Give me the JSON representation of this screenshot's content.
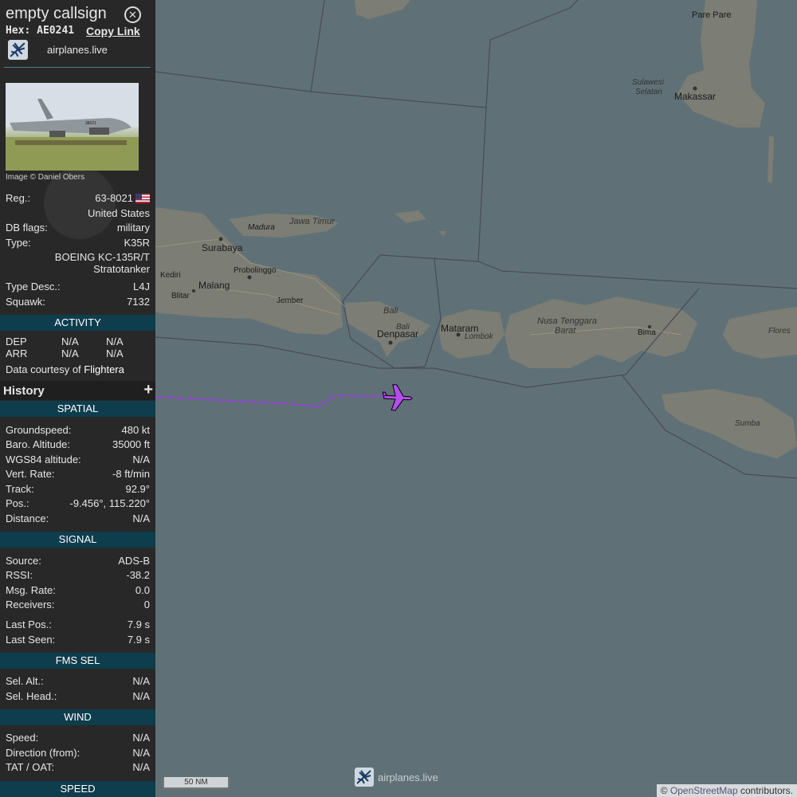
{
  "header": {
    "callsign": "empty callsign",
    "hex_label": "Hex:",
    "hex_value": "AE0241",
    "copy_link": "Copy Link",
    "site": "airplanes.live"
  },
  "photo": {
    "credit": "Image © Daniel Obers",
    "tail_number": "38021"
  },
  "info": {
    "reg_label": "Reg.:",
    "reg_value": "63-8021",
    "country": "United States",
    "db_flags_label": "DB flags:",
    "db_flags_value": "military",
    "type_label": "Type:",
    "type_value": "K35R",
    "type_name_1": "BOEING KC-135R/T",
    "type_name_2": "Stratotanker",
    "type_desc_label": "Type Desc.:",
    "type_desc_value": "L4J",
    "squawk_label": "Squawk:",
    "squawk_value": "7132"
  },
  "activity": {
    "title": "ACTIVITY",
    "dep": "DEP",
    "dep_1": "N/A",
    "dep_2": "N/A",
    "arr": "ARR",
    "arr_1": "N/A",
    "arr_2": "N/A",
    "courtesy_prefix": "Data courtesy of",
    "courtesy_link": "Flightera"
  },
  "history": {
    "title": "History",
    "toggle": "+"
  },
  "spatial": {
    "title": "SPATIAL",
    "groundspeed_label": "Groundspeed:",
    "groundspeed_value": "480",
    "groundspeed_unit": "kt",
    "baro_label": "Baro. Altitude:",
    "baro_value": "35000",
    "baro_unit": "ft",
    "wgs_label": "WGS84 altitude:",
    "wgs_value": "N/A",
    "vert_label": "Vert. Rate:",
    "vert_value": "-8",
    "vert_unit": "ft/min",
    "track_label": "Track:",
    "track_value": "92.9°",
    "pos_label": "Pos.:",
    "pos_value": "-9.456°, 115.220°",
    "distance_label": "Distance:",
    "distance_value": "N/A"
  },
  "signal": {
    "title": "SIGNAL",
    "source_label": "Source:",
    "source_value": "ADS-B",
    "rssi_label": "RSSI:",
    "rssi_value": "-38.2",
    "msg_label": "Msg. Rate:",
    "msg_value": "0.0",
    "receivers_label": "Receivers:",
    "receivers_value": "0",
    "lastpos_label": "Last Pos.:",
    "lastpos_value": "7.9 s",
    "lastseen_label": "Last Seen:",
    "lastseen_value": "7.9 s"
  },
  "fms": {
    "title": "FMS SEL",
    "alt_label": "Sel. Alt.:",
    "alt_value": "N/A",
    "head_label": "Sel. Head.:",
    "head_value": "N/A"
  },
  "wind": {
    "title": "WIND",
    "speed_label": "Speed:",
    "speed_value": "N/A",
    "dir_label": "Direction (from):",
    "dir_value": "N/A",
    "tat_label": "TAT / OAT:",
    "tat_value": "N/A"
  },
  "speed": {
    "title": "SPEED"
  },
  "map": {
    "scale": "50 NM",
    "brand": "airplanes.live",
    "attribution_prefix": "©",
    "attribution_link": "OpenStreetMap",
    "attribution_suffix": "contributors.",
    "labels": {
      "pare_pare": "Pare Pare",
      "sulawesi_1": "Sulawesi",
      "sulawesi_2": "Selatan",
      "makassar": "Makassar",
      "madura": "Madura",
      "jawa_timur": "Jawa Timur",
      "surabaya": "Surabaya",
      "kediri": "Kediri",
      "probolinggo": "Probolinggo",
      "malang": "Malang",
      "blitar": "Blitar",
      "jember": "Jember",
      "bali_region": "Bali",
      "bali_city": "Bali",
      "denpasar": "Denpasar",
      "mataram": "Mataram",
      "lombok": "Lombok",
      "ntb_1": "Nusa Tenggara",
      "ntb_2": "Barat",
      "bima": "Bima",
      "flores": "Flores",
      "sumba": "Sumba"
    }
  },
  "colors": {
    "sea": "#5f7177",
    "land": "#7a7a72",
    "sidebar_bg": "#282828",
    "section_bg": "#0e3d4d",
    "track": "#9a3fe0",
    "aircraft": "#b44cf0"
  }
}
